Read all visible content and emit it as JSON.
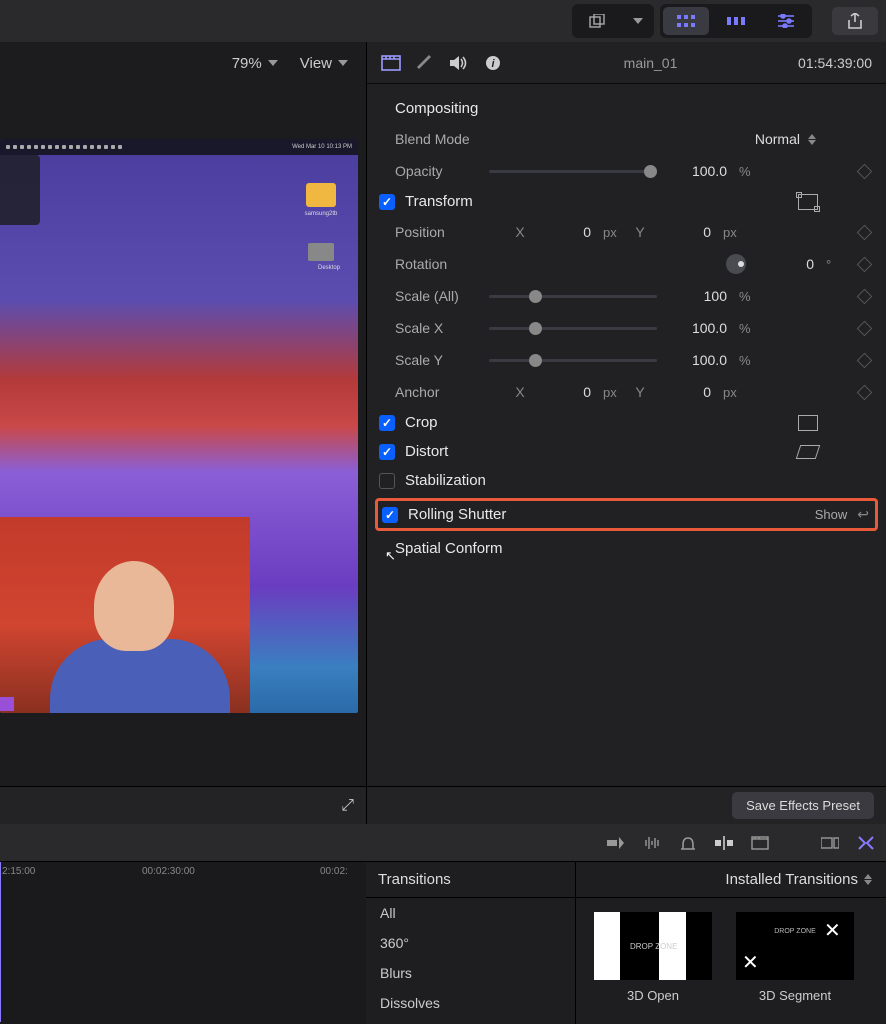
{
  "viewer": {
    "zoom": "79%",
    "view_label": "View",
    "menubar_date": "Wed Mar 10  10:13 PM",
    "folder_label": "samsung2tb",
    "desktop_label": "Desktop"
  },
  "inspector": {
    "clip_name": "main_01",
    "timecode": "01:54:39:00",
    "sections": {
      "compositing": {
        "title": "Compositing",
        "blend_mode_label": "Blend Mode",
        "blend_mode_value": "Normal",
        "opacity_label": "Opacity",
        "opacity_value": "100.0",
        "opacity_unit": "%"
      },
      "transform": {
        "title": "Transform",
        "checked": true,
        "position_label": "Position",
        "position_x": "0",
        "position_y": "0",
        "position_unit": "px",
        "rotation_label": "Rotation",
        "rotation_value": "0",
        "rotation_unit": "°",
        "scale_all_label": "Scale (All)",
        "scale_all_value": "100",
        "scale_x_label": "Scale X",
        "scale_x_value": "100.0",
        "scale_y_label": "Scale Y",
        "scale_y_value": "100.0",
        "scale_unit": "%",
        "anchor_label": "Anchor",
        "anchor_x": "0",
        "anchor_y": "0"
      },
      "crop": {
        "title": "Crop",
        "checked": true
      },
      "distort": {
        "title": "Distort",
        "checked": true
      },
      "stabilization": {
        "title": "Stabilization",
        "checked": false
      },
      "rolling_shutter": {
        "title": "Rolling Shutter",
        "checked": true,
        "show_label": "Show"
      },
      "spatial_conform": {
        "title": "Spatial Conform"
      }
    },
    "save_preset": "Save Effects Preset"
  },
  "timeline": {
    "marks": [
      "2:15:00",
      "00:02:30:00",
      "00:02:"
    ]
  },
  "transitions": {
    "header": "Transitions",
    "right_header": "Installed Transitions",
    "categories": [
      "All",
      "360°",
      "Blurs",
      "Dissolves"
    ],
    "items": [
      {
        "label": "3D Open",
        "dz": "DROP ZONE"
      },
      {
        "label": "3D Segment",
        "dz": "DROP ZONE"
      }
    ]
  }
}
